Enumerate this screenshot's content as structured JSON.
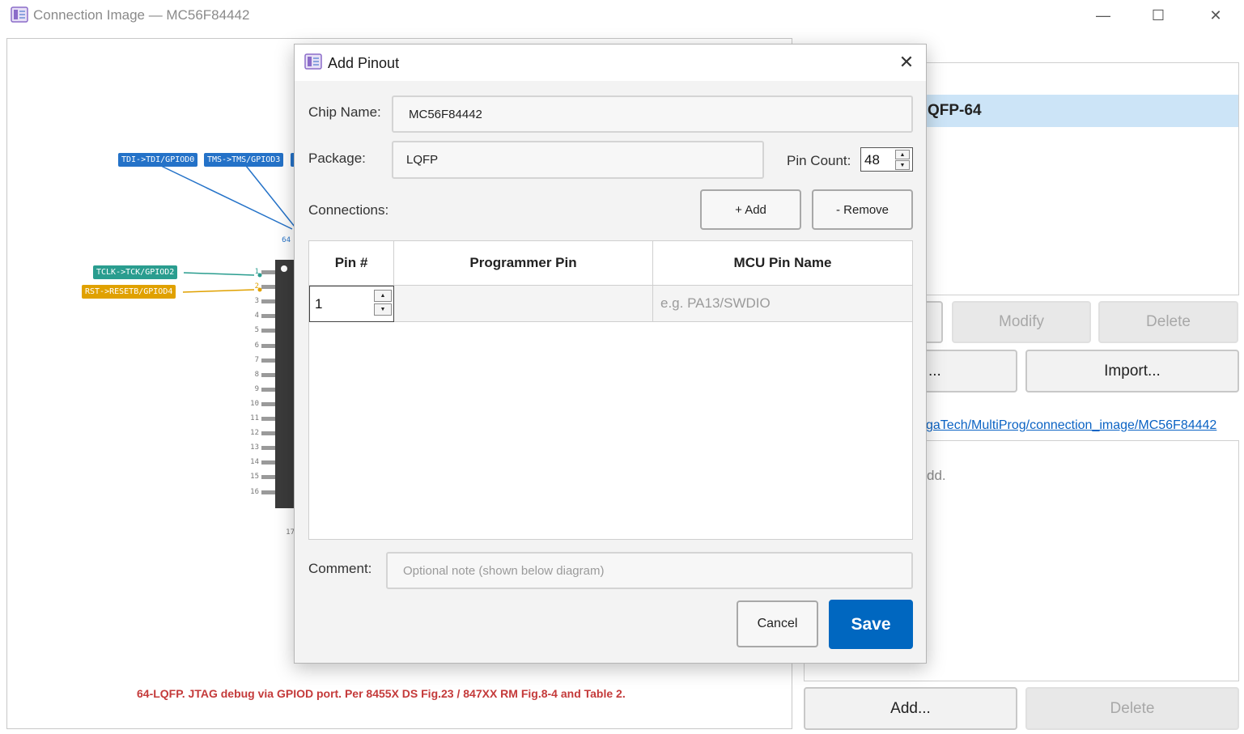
{
  "window": {
    "title": "Connection Image — MC56F84442",
    "minimize": "—",
    "maximize": "☐",
    "close": "✕"
  },
  "diagram": {
    "top_tags": [
      "TDI->TDI/GPIOD0",
      "TMS->TMS/GPIOD3"
    ],
    "side_tags": [
      {
        "text": "TCLK->TCK/GPIOD2",
        "color": "#2a9d8f"
      },
      {
        "text": "RST->RESETB/GPIOD4",
        "color": "#e0a100"
      }
    ],
    "top_tag_color": "#2472c8",
    "pin_numbers": [
      "1",
      "2",
      "3",
      "4",
      "5",
      "6",
      "7",
      "8",
      "9",
      "10",
      "11",
      "12",
      "13",
      "14",
      "15",
      "16"
    ],
    "pin_64_label": "64",
    "pin_17_label": "17",
    "comment": "64-LQFP. JTAG debug via GPIOD port. Per 8455X DS Fig.23 / 847XX RM Fig.8-4 and Table 2."
  },
  "right_panel": {
    "list_selected": "QFP-64",
    "modify_label": "Modify",
    "delete_label": "Delete",
    "export_label": "...",
    "import_label": "Import...",
    "path_link": "gaTech/MultiProg/connection_image/MC56F84442",
    "hint_text": "dd.",
    "add_label": "Add...",
    "delete_bottom_label": "Delete"
  },
  "dialog": {
    "title": "Add Pinout",
    "close": "✕",
    "chip_name_label": "Chip Name:",
    "chip_name_value": "MC56F84442",
    "package_label": "Package:",
    "package_value": "LQFP",
    "pin_count_label": "Pin Count:",
    "pin_count_value": "48",
    "connections_label": "Connections:",
    "add_button": "+ Add",
    "remove_button": "- Remove",
    "table": {
      "headers": [
        "Pin #",
        "Programmer Pin",
        "MCU Pin Name"
      ],
      "rows": [
        {
          "pin": "1",
          "programmer_pin": "",
          "mcu_pin_placeholder": "e.g. PA13/SWDIO"
        }
      ]
    },
    "comment_label": "Comment:",
    "comment_placeholder": "Optional note (shown below diagram)",
    "cancel_button": "Cancel",
    "save_button": "Save",
    "accent_color": "#0067c0"
  }
}
